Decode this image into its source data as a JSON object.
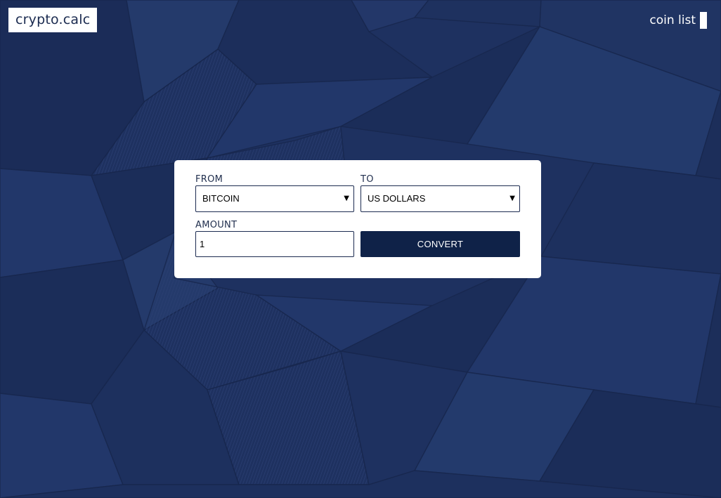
{
  "header": {
    "logo_text": "crypto.calc",
    "nav_link": "coin list"
  },
  "converter": {
    "from_label": "FROM",
    "from_value": "BITCOIN",
    "to_label": "TO",
    "to_value": "US DOLLARS",
    "amount_label": "AMOUNT",
    "amount_value": "1",
    "convert_label": "CONVERT"
  },
  "colors": {
    "background": "#1e3160",
    "button": "#0f2248",
    "card": "#ffffff"
  },
  "icons": {
    "dropdown": "chevron-down-icon"
  }
}
